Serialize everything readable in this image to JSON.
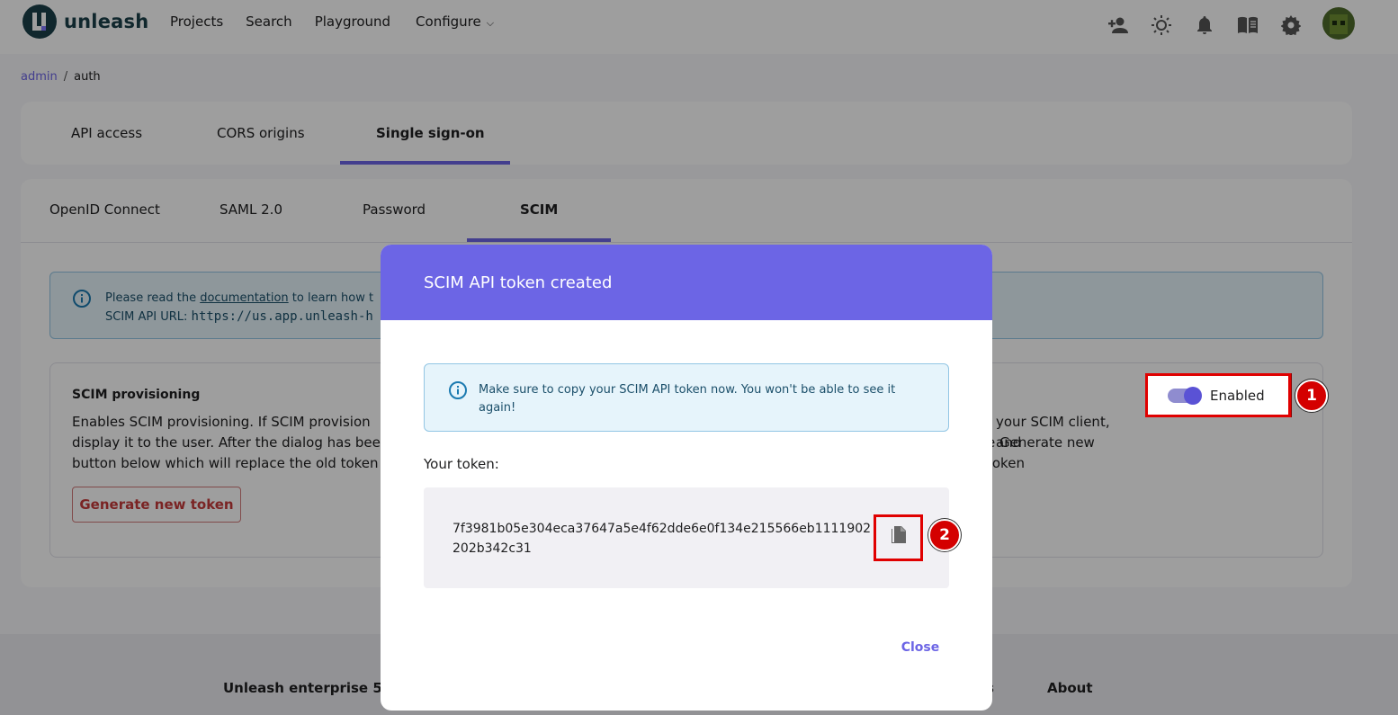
{
  "app": {
    "logo_text": "unleash"
  },
  "nav": {
    "links": [
      "Projects",
      "Search",
      "Playground",
      "Configure"
    ]
  },
  "breadcrumb": {
    "link": "admin",
    "separator": "/",
    "current": "auth"
  },
  "outer_tabs": [
    "API access",
    "CORS origins",
    "Single sign-on"
  ],
  "inner_tabs": [
    "OpenID Connect",
    "SAML 2.0",
    "Password",
    "SCIM"
  ],
  "info": {
    "prefix": "Please read the ",
    "doc_link": "documentation",
    "suffix": " to learn how t",
    "url_label": "SCIM API URL: ",
    "url_value": "https://us.app.unleash-h"
  },
  "provisioning": {
    "title": "SCIM provisioning",
    "description_line1": "Enables SCIM provisioning. If SCIM provision",
    "description_line1_end": "your SCIM client, and",
    "description_line2": "display it to the user. After the dialog has bee",
    "description_line2_end": "e Generate new token",
    "description_line3": "button below which will replace the old token",
    "generate_button": "Generate new token",
    "toggle_label": "Enabled",
    "toggle_on": true
  },
  "markers": [
    "1",
    "2"
  ],
  "dialog": {
    "title": "SCIM API token created",
    "info_text": "Make sure to copy your SCIM API token now. You won't be able to see it again!",
    "token_label": "Your token:",
    "token": "7f3981b05e304eca37647a5e4f62dde6e0f134e215566eb1111902202b342c31",
    "close_button": "Close"
  },
  "footer": {
    "brand": "Unleash enterprise 5.12",
    "fragment": "s",
    "about": "About"
  },
  "colors": {
    "accent": "#6c65e5",
    "highlight": "#e00000"
  }
}
